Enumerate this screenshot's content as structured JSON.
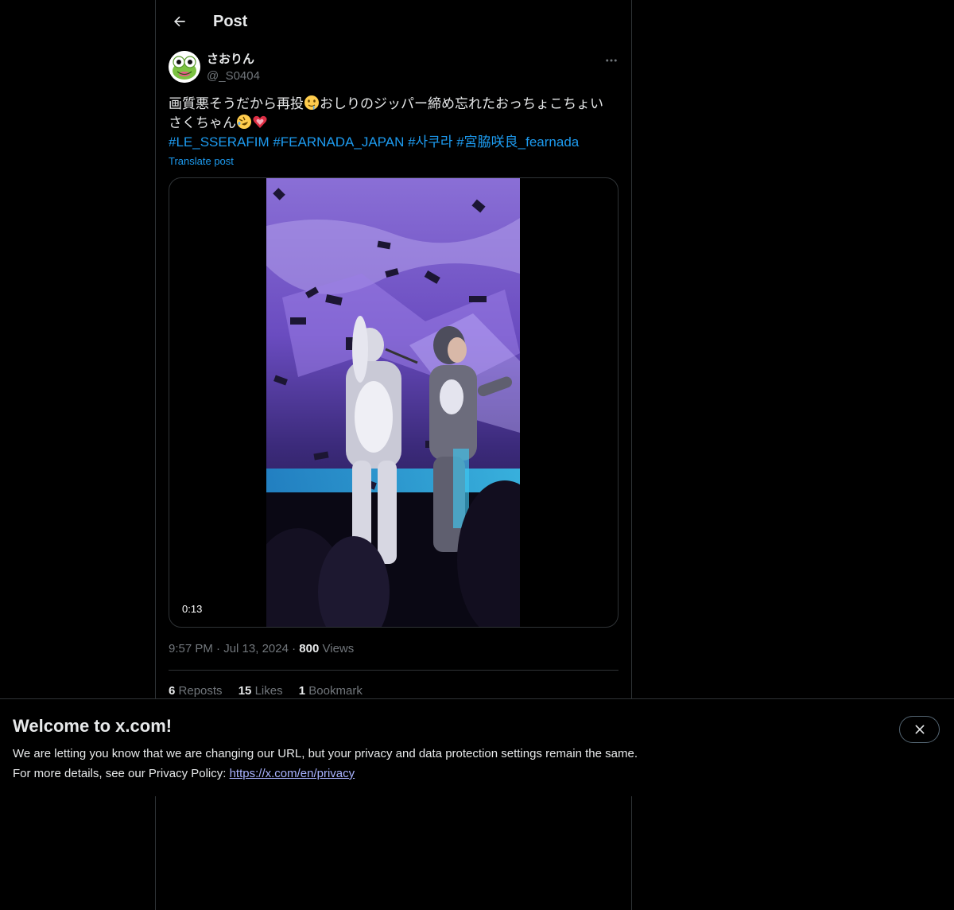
{
  "header": {
    "back_icon": "arrow-left-icon",
    "title": "Post"
  },
  "post": {
    "author": {
      "display_name": "さおりん",
      "handle": "@_S0404",
      "avatar_icon": "frog-avatar"
    },
    "more_icon": "more-horizontal-icon",
    "text_part1": "画質悪そうだから再投",
    "emoji1": "drooling-face-emoji",
    "text_part2": "おしりのジッパー締め忘れたおっちょこちょい",
    "text_part3": "さくちゃん",
    "emoji2": "rolling-on-floor-laughing-emoji",
    "emoji3": "growing-heart-emoji",
    "hashtags": [
      "#LE_SSERAFIM",
      "#FEARNADA_JAPAN",
      "#사쿠라",
      "#宮脇咲良_fearnada"
    ],
    "translate_label": "Translate post",
    "media": {
      "type": "video",
      "duration": "0:13"
    },
    "time": "9:57 PM",
    "date": "Jul 13, 2024",
    "separator": "·",
    "views_count": "800",
    "views_label": "Views",
    "stats": {
      "reposts_count": "6",
      "reposts_label": "Reposts",
      "likes_count": "15",
      "likes_label": "Likes",
      "bookmarks_count": "1",
      "bookmarks_label": "Bookmark"
    }
  },
  "banner": {
    "title": "Welcome to x.com!",
    "line1": "We are letting you know that we are changing our URL, but your privacy and data protection settings remain the same.",
    "line2_prefix": "For more details, see our Privacy Policy: ",
    "link_text": "https://x.com/en/privacy",
    "close_icon": "close-icon"
  },
  "colors": {
    "background": "#000000",
    "text": "#e7e9ea",
    "muted": "#71767b",
    "link": "#1d9bf0",
    "border": "#2f3336"
  }
}
